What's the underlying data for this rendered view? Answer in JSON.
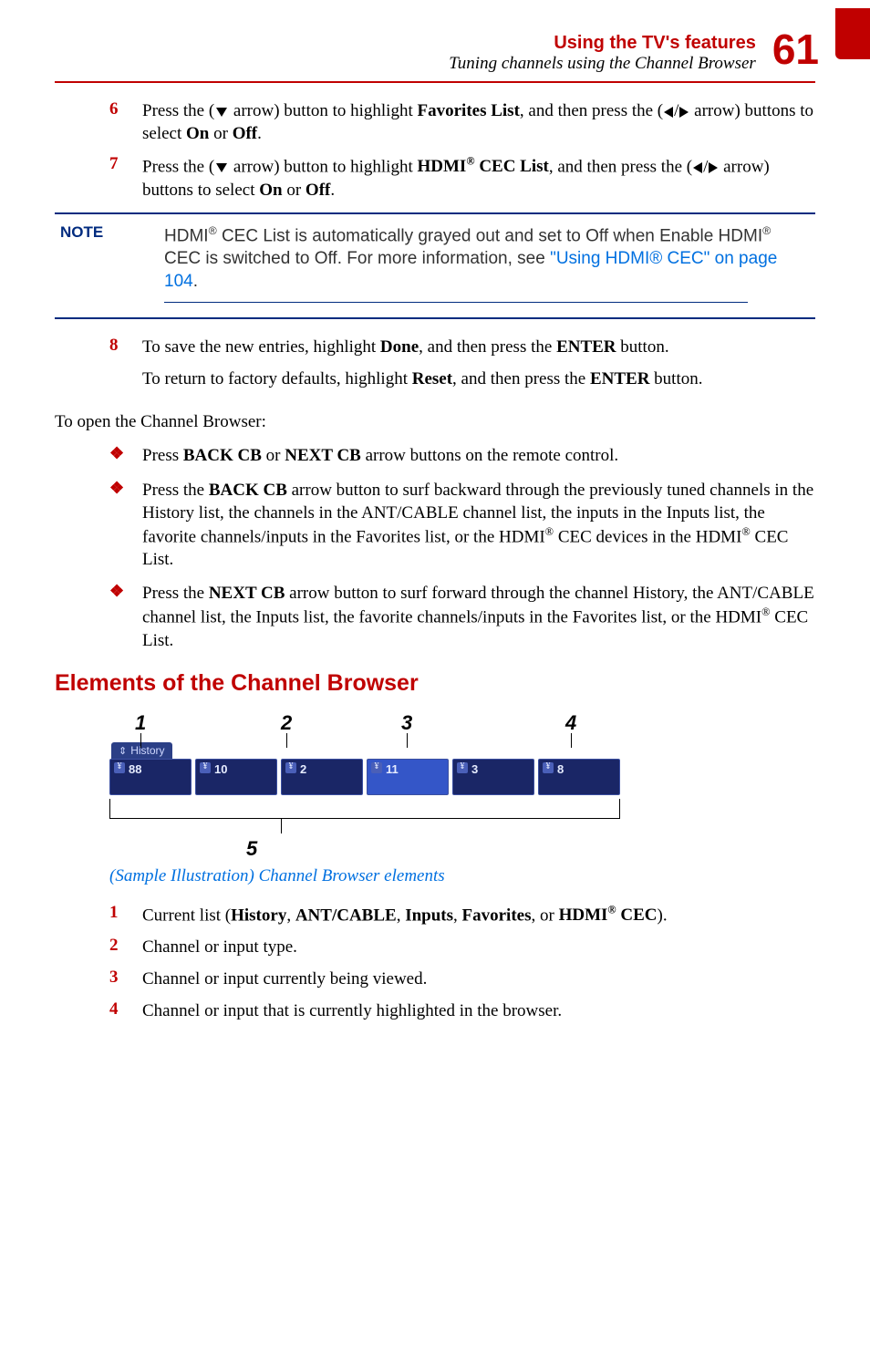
{
  "header": {
    "title": "Using the TV's features",
    "subtitle": "Tuning channels using the Channel Browser",
    "page": "61"
  },
  "steps_a": [
    {
      "n": "6",
      "pre": "Press the (",
      "mid1": " arrow) button to highlight ",
      "b1": "Favorites List",
      "mid2": ", and then press the (",
      "mid3": " arrow) buttons to select ",
      "onoff1": "On",
      "or": " or ",
      "onoff2": "Off",
      "end": "."
    },
    {
      "n": "7",
      "pre": "Press the (",
      "mid1": " arrow) button to highlight ",
      "b1": "HDMI",
      "b1sup": "®",
      "b1b": " CEC List",
      "mid2": ", and then press the (",
      "mid3": " arrow) buttons to select ",
      "onoff1": "On",
      "or": " or ",
      "onoff2": "Off",
      "end": "."
    }
  ],
  "note": {
    "label": "NOTE",
    "text_a": "HDMI",
    "sup": "®",
    "text_b": " CEC List is automatically grayed out and set to Off when Enable HDMI",
    "sup2": "®",
    "text_c": " CEC is switched to Off. For more information, see ",
    "link": "\"Using HDMI® CEC\" on page 104",
    "text_d": "."
  },
  "step8": {
    "n": "8",
    "a": "To save the new entries, highlight ",
    "b1": "Done",
    "b": ", and then press the ",
    "b2": "ENTER",
    "c": " button.",
    "ret_a": "To return to factory defaults, highlight ",
    "ret_b1": "Reset",
    "ret_b": ", and then press the ",
    "ret_b2": "ENTER",
    "ret_c": " button."
  },
  "open_line": "To open the Channel Browser:",
  "bullets": [
    {
      "pre": "Press ",
      "b1": "BACK CB",
      "mid": " or ",
      "b2": "NEXT CB",
      "post": " arrow buttons on the remote control."
    },
    {
      "pre": "Press the ",
      "b1": "BACK CB",
      "post_a": " arrow button to surf backward through the previously tuned channels in the History list, the channels in the ANT/CABLE channel list, the inputs in the Inputs list, the favorite channels/inputs in the Favorites list, or the HDMI",
      "sup1": "®",
      "post_b": " CEC devices in the HDMI",
      "sup2": "®",
      "post_c": " CEC List."
    },
    {
      "pre": "Press the ",
      "b1": "NEXT CB",
      "post_a": " arrow button to surf forward through the channel History, the ANT/CABLE channel list, the Inputs list, the favorite channels/inputs in the Favorites list, or the HDMI",
      "sup1": "®",
      "post_b": " CEC List."
    }
  ],
  "section_heading": "Elements of the Channel Browser",
  "figure": {
    "labels": [
      "1",
      "2",
      "3",
      "4",
      "5"
    ],
    "history": "History",
    "cells": [
      "88",
      "10",
      "2",
      "11",
      "3",
      "8"
    ],
    "caption": "(Sample Illustration) Channel Browser elements"
  },
  "legend": [
    {
      "n": "1",
      "pre": "Current list (",
      "b1": "History",
      "s1": ", ",
      "b2": "ANT/CABLE",
      "s2": ", ",
      "b3": "Inputs",
      "s3": ", ",
      "b4": "Favorites",
      "s4": ", or ",
      "b5": "HDMI",
      "sup": "®",
      "b5b": " CEC",
      "end": ")."
    },
    {
      "n": "2",
      "text": "Channel or input type."
    },
    {
      "n": "3",
      "text": "Channel or input currently being viewed."
    },
    {
      "n": "4",
      "text": "Channel or input that is currently highlighted in the browser."
    }
  ]
}
